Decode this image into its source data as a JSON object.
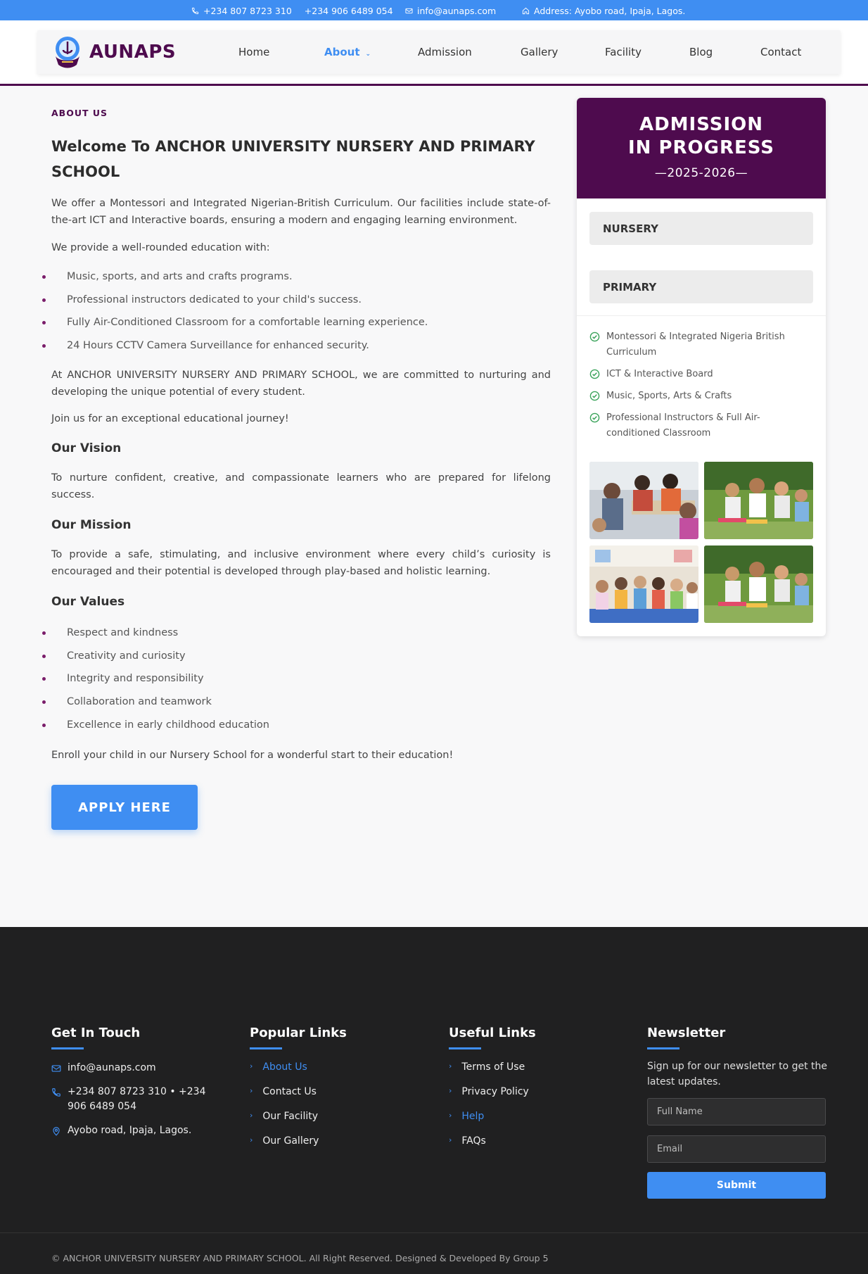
{
  "topbar": {
    "phone1": "+234 807 8723 310",
    "phone2": "+234 906 6489 054",
    "email": "info@aunaps.com",
    "address": "Address: Ayobo road, Ipaja, Lagos."
  },
  "brand": {
    "name": "AUNAPS"
  },
  "nav": {
    "items": [
      "Home",
      "About",
      "Admission",
      "Gallery",
      "Facility",
      "Blog",
      "Contact"
    ],
    "active": "About"
  },
  "about": {
    "eyebrow": "ABOUT US",
    "title": "Welcome To ANCHOR UNIVERSITY NURSERY AND PRIMARY SCHOOL",
    "intro": "We offer a Montessori and Integrated Nigerian-British Curriculum. Our facilities include state-of-the-art ICT and Interactive boards, ensuring a modern and engaging learning environment.",
    "provide": "We provide a well-rounded education with:",
    "offerings": [
      "Music, sports, and arts and crafts programs.",
      "Professional instructors dedicated to your child's success.",
      "Fully Air-Conditioned Classroom for a comfortable learning experience.",
      "24 Hours CCTV Camera Surveillance for enhanced security."
    ],
    "commitment": "At ANCHOR UNIVERSITY NURSERY AND PRIMARY SCHOOL, we are committed to nurturing and developing the unique potential of every student.",
    "join": "Join us for an exceptional educational journey!",
    "vision_title": "Our Vision",
    "vision": "To nurture confident, creative, and compassionate learners who are prepared for lifelong success.",
    "mission_title": "Our Mission",
    "mission": "To provide a safe, stimulating, and inclusive environment where every child’s curiosity is encouraged and their potential is developed through play-based and holistic learning.",
    "values_title": "Our Values",
    "values": [
      "Respect and kindness",
      "Creativity and curiosity",
      "Integrity and responsibility",
      "Collaboration and teamwork",
      "Excellence in early childhood education"
    ],
    "enroll": "Enroll your child in our Nursery School for a wonderful start to their education!",
    "apply_label": "APPLY HERE"
  },
  "admission_card": {
    "line1": "ADMISSION",
    "line2": "IN PROGRESS",
    "session": "—2025-2026—",
    "levels": [
      "NURSERY",
      "PRIMARY"
    ],
    "features": [
      "Montessori & Integrated Nigeria British Curriculum",
      "ICT & Interactive Board",
      "Music, Sports, Arts & Crafts",
      "Professional Instructors & Full Air-conditioned Classroom"
    ]
  },
  "footer": {
    "contact_title": "Get In Touch",
    "contact_email": "info@aunaps.com",
    "contact_phone": "+234 807 8723 310 • +234 906 6489 054",
    "contact_address": "Ayobo road, Ipaja, Lagos.",
    "popular_title": "Popular Links",
    "popular_links": [
      "About Us",
      "Contact Us",
      "Our Facility",
      "Our Gallery"
    ],
    "useful_title": "Useful Links",
    "useful_links": [
      "Terms of Use",
      "Privacy Policy",
      "Help",
      "FAQs"
    ],
    "newsletter_title": "Newsletter",
    "newsletter_text": "Sign up for our newsletter to get the latest updates.",
    "name_placeholder": "Full Name",
    "email_placeholder": "Email",
    "submit_label": "Submit",
    "copyright": "© ANCHOR UNIVERSITY NURSERY AND PRIMARY SCHOOL. All Right Reserved. Designed & Developed By Group 5"
  },
  "colors": {
    "brand_purple": "#4e0b4e",
    "accent_blue": "#3f8ef2",
    "footer_bg": "#202021",
    "check_green": "#3aa35a"
  }
}
